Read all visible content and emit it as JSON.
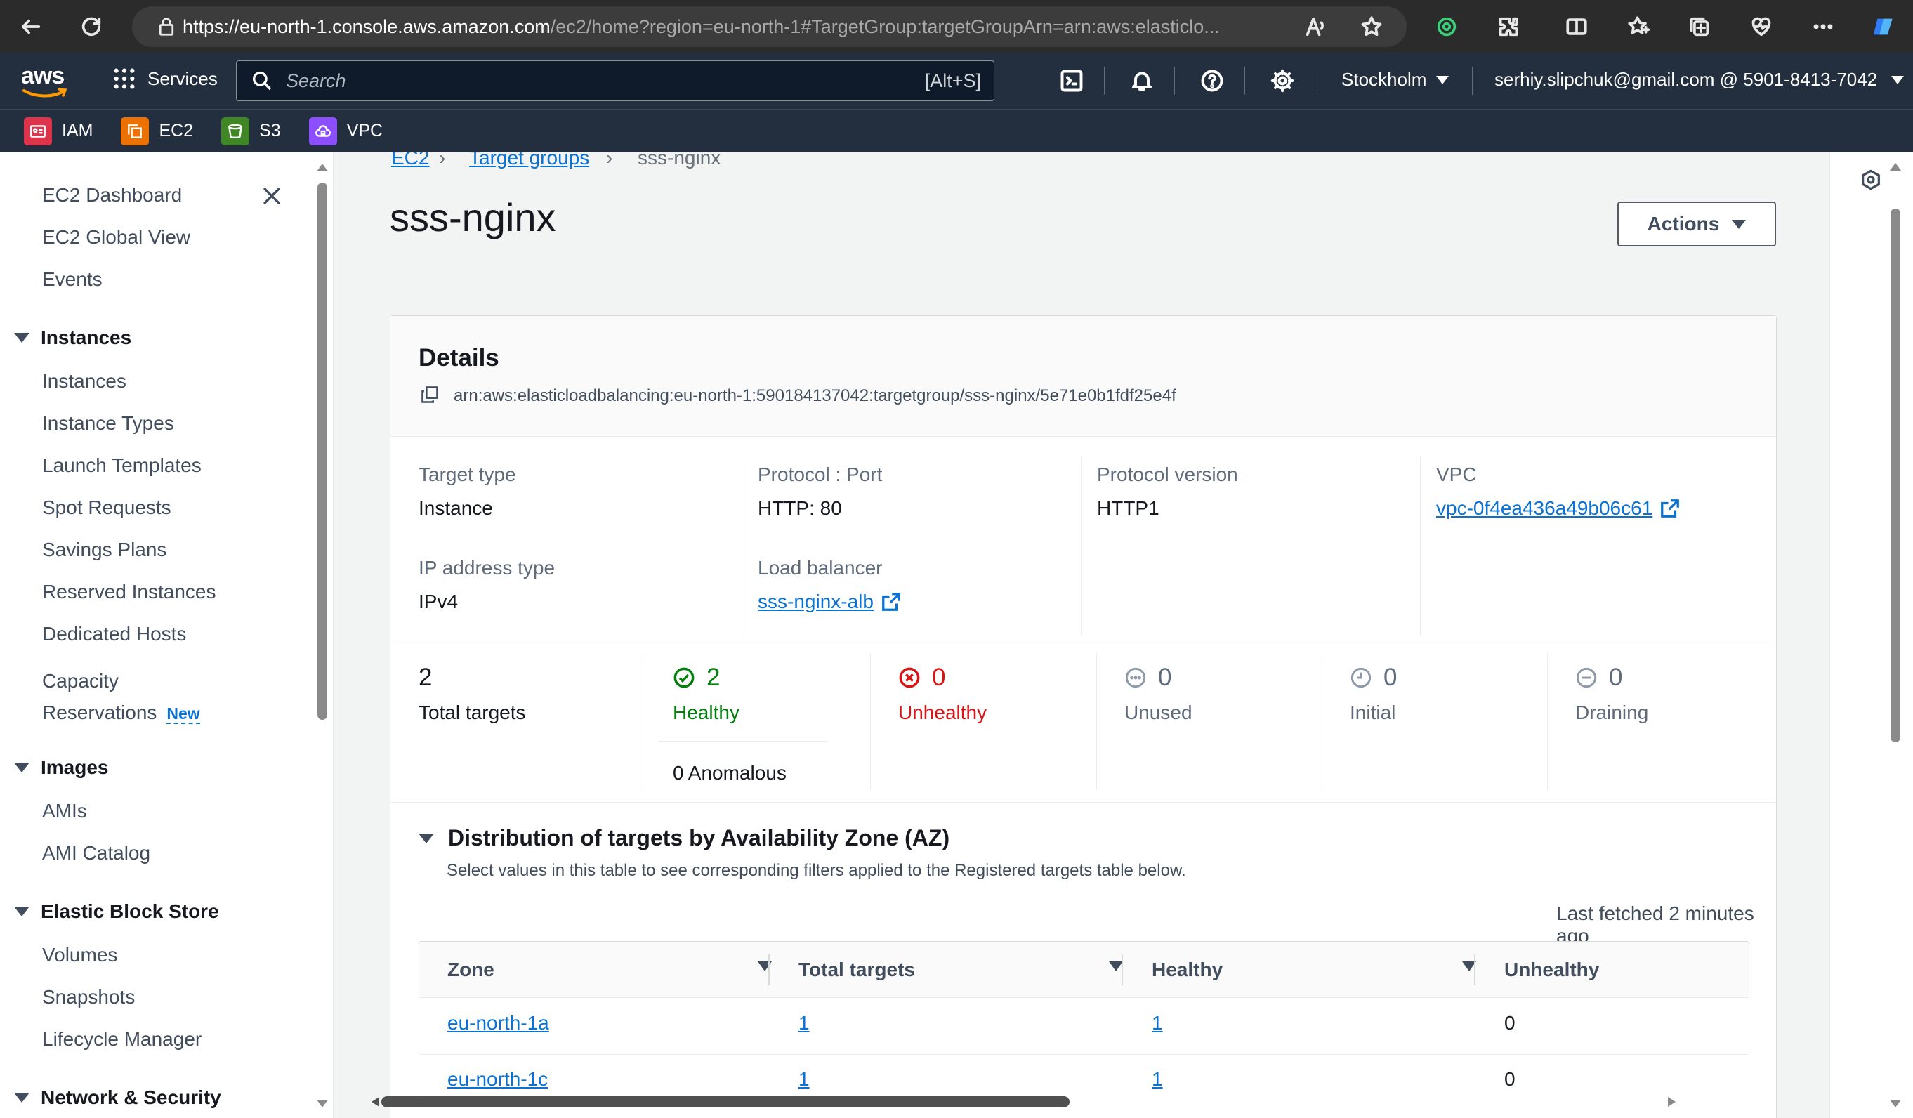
{
  "browser": {
    "url_host": "https://eu-north-1.console.aws.amazon.com",
    "url_path": "/ec2/home?region=eu-north-1#TargetGroup:targetGroupArn=arn:aws:elasticlo..."
  },
  "aws_nav": {
    "logo": "aws",
    "services_label": "Services",
    "search_placeholder": "Search",
    "search_shortcut": "[Alt+S]",
    "region": "Stockholm",
    "account": "serhiy.slipchuk@gmail.com @ 5901-8413-7042"
  },
  "favorites": [
    {
      "label": "IAM",
      "color": "#dd344c"
    },
    {
      "label": "EC2",
      "color": "#ed7100"
    },
    {
      "label": "S3",
      "color": "#3f8624"
    },
    {
      "label": "VPC",
      "color": "#8c4fff"
    }
  ],
  "sidebar": {
    "top_items": [
      "EC2 Dashboard",
      "EC2 Global View",
      "Events"
    ],
    "instances_header": "Instances",
    "instances_items": [
      "Instances",
      "Instance Types",
      "Launch Templates",
      "Spot Requests",
      "Savings Plans",
      "Reserved Instances",
      "Dedicated Hosts"
    ],
    "capacity_line1": "Capacity",
    "capacity_line2": "Reservations",
    "new_badge": "New",
    "images_header": "Images",
    "images_items": [
      "AMIs",
      "AMI Catalog"
    ],
    "ebs_header": "Elastic Block Store",
    "ebs_items": [
      "Volumes",
      "Snapshots",
      "Lifecycle Manager"
    ],
    "network_header": "Network & Security"
  },
  "breadcrumb": {
    "ec2": "EC2",
    "target_groups": "Target groups",
    "current": "sss-nginx"
  },
  "page_title": "sss-nginx",
  "actions_label": "Actions",
  "details": {
    "title": "Details",
    "arn": "arn:aws:elasticloadbalancing:eu-north-1:590184137042:targetgroup/sss-nginx/5e71e0b1fdf25e4f",
    "target_type_label": "Target type",
    "target_type": "Instance",
    "protocol_port_label": "Protocol : Port",
    "protocol_port": "HTTP: 80",
    "protocol_version_label": "Protocol version",
    "protocol_version": "HTTP1",
    "vpc_label": "VPC",
    "vpc": "vpc-0f4ea436a49b06c61",
    "ip_type_label": "IP address type",
    "ip_type": "IPv4",
    "lb_label": "Load balancer",
    "lb": "sss-nginx-alb"
  },
  "targets": {
    "total": "2",
    "total_label": "Total targets",
    "healthy": "2",
    "healthy_label": "Healthy",
    "anomalous": "0 Anomalous",
    "unhealthy": "0",
    "unhealthy_label": "Unhealthy",
    "unused": "0",
    "unused_label": "Unused",
    "initial": "0",
    "initial_label": "Initial",
    "draining": "0",
    "draining_label": "Draining"
  },
  "distribution": {
    "title": "Distribution of targets by Availability Zone (AZ)",
    "description": "Select values in this table to see corresponding filters applied to the Registered targets table below.",
    "last_fetched": "Last fetched 2 minutes ago",
    "columns": [
      "Zone",
      "Total targets",
      "Healthy",
      "Unhealthy"
    ],
    "rows": [
      {
        "zone": "eu-north-1a",
        "total": "1",
        "healthy": "1",
        "unhealthy": "0"
      },
      {
        "zone": "eu-north-1c",
        "total": "1",
        "healthy": "1",
        "unhealthy": "0"
      }
    ]
  }
}
